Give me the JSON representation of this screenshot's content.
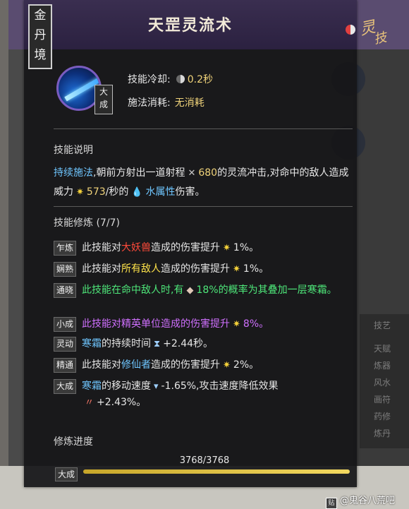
{
  "realm": [
    "金",
    "丹",
    "境"
  ],
  "title": "天罡灵流术",
  "logo_text": [
    "灵",
    "技"
  ],
  "skill": {
    "rank": "大\n成",
    "cooldown_label": "技能冷却:",
    "cooldown_value": "0.2秒",
    "cost_label": "施法消耗:",
    "cost_value": "无消耗"
  },
  "description": {
    "heading": "技能说明",
    "part1": "持续施法",
    "part2": ",朝前方射出一道射程",
    "range": "680",
    "part3": "的灵流冲击,对命中的敌人造成威力",
    "power": "573",
    "part4": "/秒的",
    "element": "水属性",
    "part5": "伤害。"
  },
  "training": {
    "heading": "技能修炼 (7/7)",
    "rows": [
      {
        "label": "乍炼",
        "pre": "此技能对",
        "hl": "大妖兽",
        "post": "造成的伤害提升",
        "val": "1%。"
      },
      {
        "label": "娴熟",
        "pre": "此技能对",
        "hl": "所有敌人",
        "post": "造成的伤害提升",
        "val": "1%。"
      },
      {
        "label": "通晓",
        "pre": "此技能在命中敌人时,有",
        "hl": "",
        "post": "",
        "val": "18%的概率为其叠加一层寒霜。"
      },
      {
        "label": "小成",
        "pre": "此技能对精英单位造成的伤害提升",
        "hl": "",
        "post": "",
        "val": "8%。"
      },
      {
        "label": "灵动",
        "pre": "寒霜",
        "hl": "",
        "post": "的持续时间",
        "val": "+2.44秒。"
      },
      {
        "label": "精通",
        "pre": "此技能对",
        "hl": "修仙者",
        "post": "造成的伤害提升",
        "val": "2%。"
      },
      {
        "label": "大成",
        "pre": "寒霜",
        "hl": "",
        "post": "的移动速度",
        "val": "-1.65%,攻击速度降低效果",
        "val2": "+2.43%。"
      }
    ]
  },
  "progress": {
    "label": "修炼进度",
    "count": "3768/3768",
    "fraction": 1.0,
    "rank": "大成"
  },
  "watermark": "@鬼谷八荒吧",
  "bg_right": [
    "技艺",
    "天赋",
    "炼器",
    "风水",
    "画符",
    "药修",
    "炼丹"
  ]
}
